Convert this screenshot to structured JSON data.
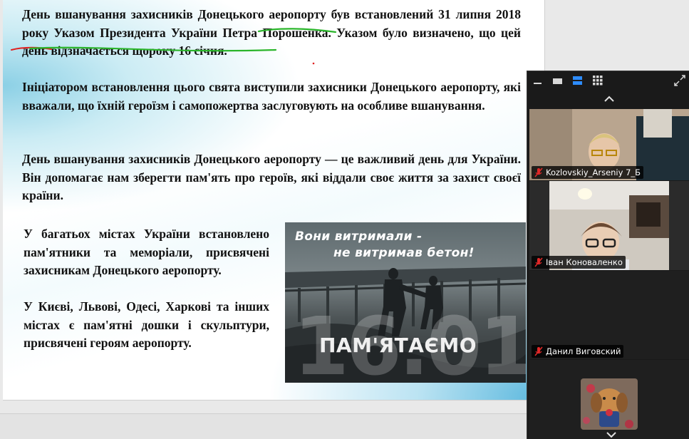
{
  "slide": {
    "paragraph1": "День вшанування захисників Донецького аеропорту був встановлений 31 липня 2018 року Указом Президента України Петра Порошенка. Указом було визначено, що цей день відзначається щороку 16 січня.",
    "paragraph2": "Ініціатором встановлення цього свята виступили захисники Донецького аеропорту, які вважали, що їхній героїзм і самопожертва заслуговують на особливе вшанування.",
    "paragraph3": "День вшанування захисників Донецького аеропорту — це важливий день для України. Він допомагає нам зберегти пам'ять про героїв, які віддали своє життя за захист своєї країни.",
    "paragraph4": "У багатьох містах України встановлено пам'ятники та меморіали, присвячені захисникам Донецького аеропорту.",
    "paragraph5": "У Києві, Львові, Одесі, Харкові та інших містах є пам'ятні дошки і скульптури, присвячені героям аеропорту.",
    "poster": {
      "line1": "Вони витримали -",
      "line2": "не витримав бетон!",
      "date": "16.01",
      "caption": "ПАМ'ЯТАЄМО"
    },
    "colors": {
      "accent_blue": "#3aaed8",
      "annotation_green": "#2bb52b",
      "annotation_red": "#e02020"
    }
  },
  "zoom_panel": {
    "toolbar_icons": [
      "minimize-icon",
      "hide-video-icon",
      "speaker-view-icon",
      "gallery-view-icon",
      "exit-fullscreen-icon"
    ],
    "participants": [
      {
        "name": "Kozlovskiy_Arseniy 7_Б",
        "muted": true
      },
      {
        "name": "Іван Коноваленко",
        "muted": true
      },
      {
        "name": "Данил Виговский",
        "muted": true
      },
      {
        "name": "",
        "muted": false
      }
    ],
    "colors": {
      "panel_bg": "#1a1a1a",
      "active_view": "#2d8cff",
      "muted_red": "#e02828"
    }
  }
}
